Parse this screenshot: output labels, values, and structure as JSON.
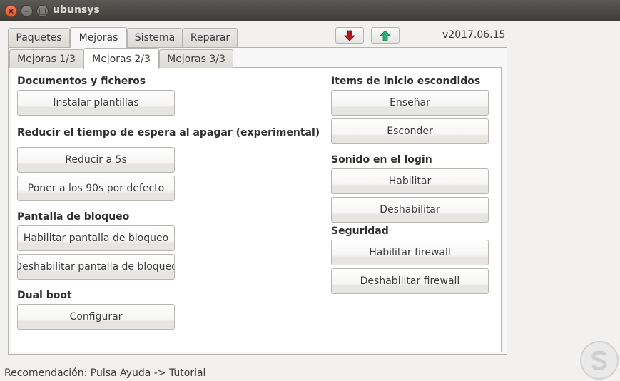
{
  "window": {
    "title": "ubunsys",
    "close_glyph": "×",
    "min_glyph": "–",
    "max_glyph": "□"
  },
  "tabs": [
    "Paquetes",
    "Mejoras",
    "Sistema",
    "Reparar"
  ],
  "subtabs": [
    "Mejoras 1/3",
    "Mejoras 2/3",
    "Mejoras 3/3"
  ],
  "version": "v2017.06.15",
  "toolbar": {
    "down_icon": "red-down-arrow-icon",
    "up_icon": "green-up-arrow-icon",
    "down_color": "#b01c1c",
    "up_color": "#2fae7a"
  },
  "left": {
    "docs_title": "Documentos y ficheros",
    "docs_install": "Instalar plantillas",
    "shutdown_title": "Reducir el tiempo de espera al apagar (experimental)",
    "shutdown_reduce": "Reducir a 5s",
    "shutdown_default": "Poner a los 90s por defecto",
    "lock_title": "Pantalla de bloqueo",
    "lock_enable": "Habilitar pantalla de bloqueo",
    "lock_disable": "Deshabilitar pantalla de bloqueo",
    "dual_title": "Dual boot",
    "dual_config": "Configurar"
  },
  "right": {
    "startup_title": "Items de inicio escondidos",
    "startup_show": "Enseñar",
    "startup_hide": "Esconder",
    "sound_title": "Sonido en el login",
    "sound_enable": "Habilitar",
    "sound_disable": "Deshabilitar",
    "security_title": "Seguridad",
    "firewall_enable": "Habilitar firewall",
    "firewall_disable": "Deshabilitar firewall"
  },
  "status": "Recomendación: Pulsa Ayuda -> Tutorial",
  "watermark": {
    "icon": "solvetic-s-logo-icon",
    "color": "#d9d9d9"
  }
}
